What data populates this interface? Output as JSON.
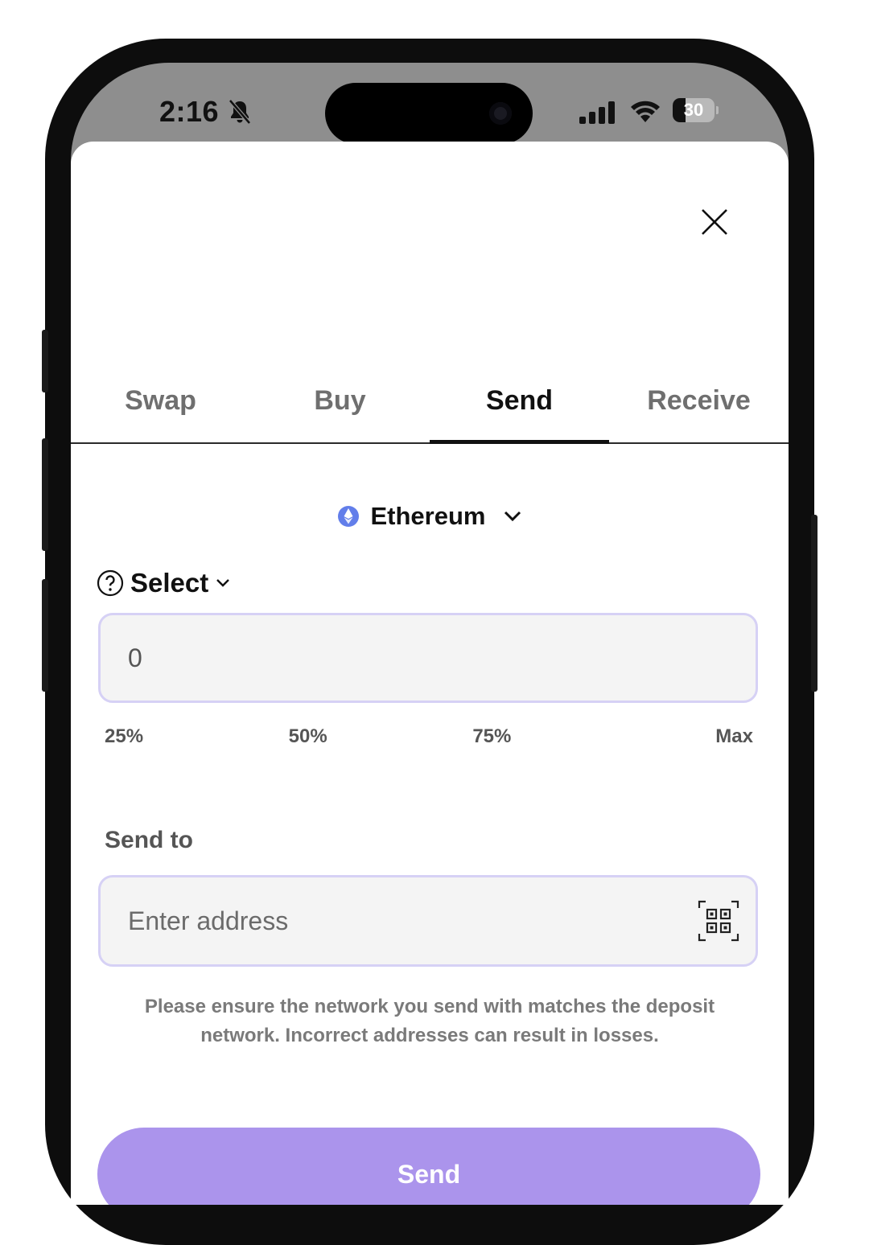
{
  "status_bar": {
    "time": "2:16",
    "battery": "30",
    "battery_level": 0.3
  },
  "tabs": [
    {
      "label": "Swap",
      "active": false
    },
    {
      "label": "Buy",
      "active": false
    },
    {
      "label": "Send",
      "active": true
    },
    {
      "label": "Receive",
      "active": false
    }
  ],
  "network": {
    "label": "Ethereum",
    "icon": "ethereum-icon",
    "icon_color": "#627eea"
  },
  "token": {
    "label": "Select"
  },
  "amount": {
    "placeholder": "0",
    "value": ""
  },
  "percent_options": [
    "25%",
    "50%",
    "75%",
    "Max"
  ],
  "send_to": {
    "label": "Send to",
    "placeholder": "Enter address"
  },
  "warning": "Please ensure the network you send with matches the deposit network. Incorrect addresses can result in losses.",
  "send_button": {
    "label": "Send",
    "color": "#ab94ec"
  },
  "colors": {
    "accent": "#ab94ec",
    "input_border": "#d6d1f5"
  }
}
